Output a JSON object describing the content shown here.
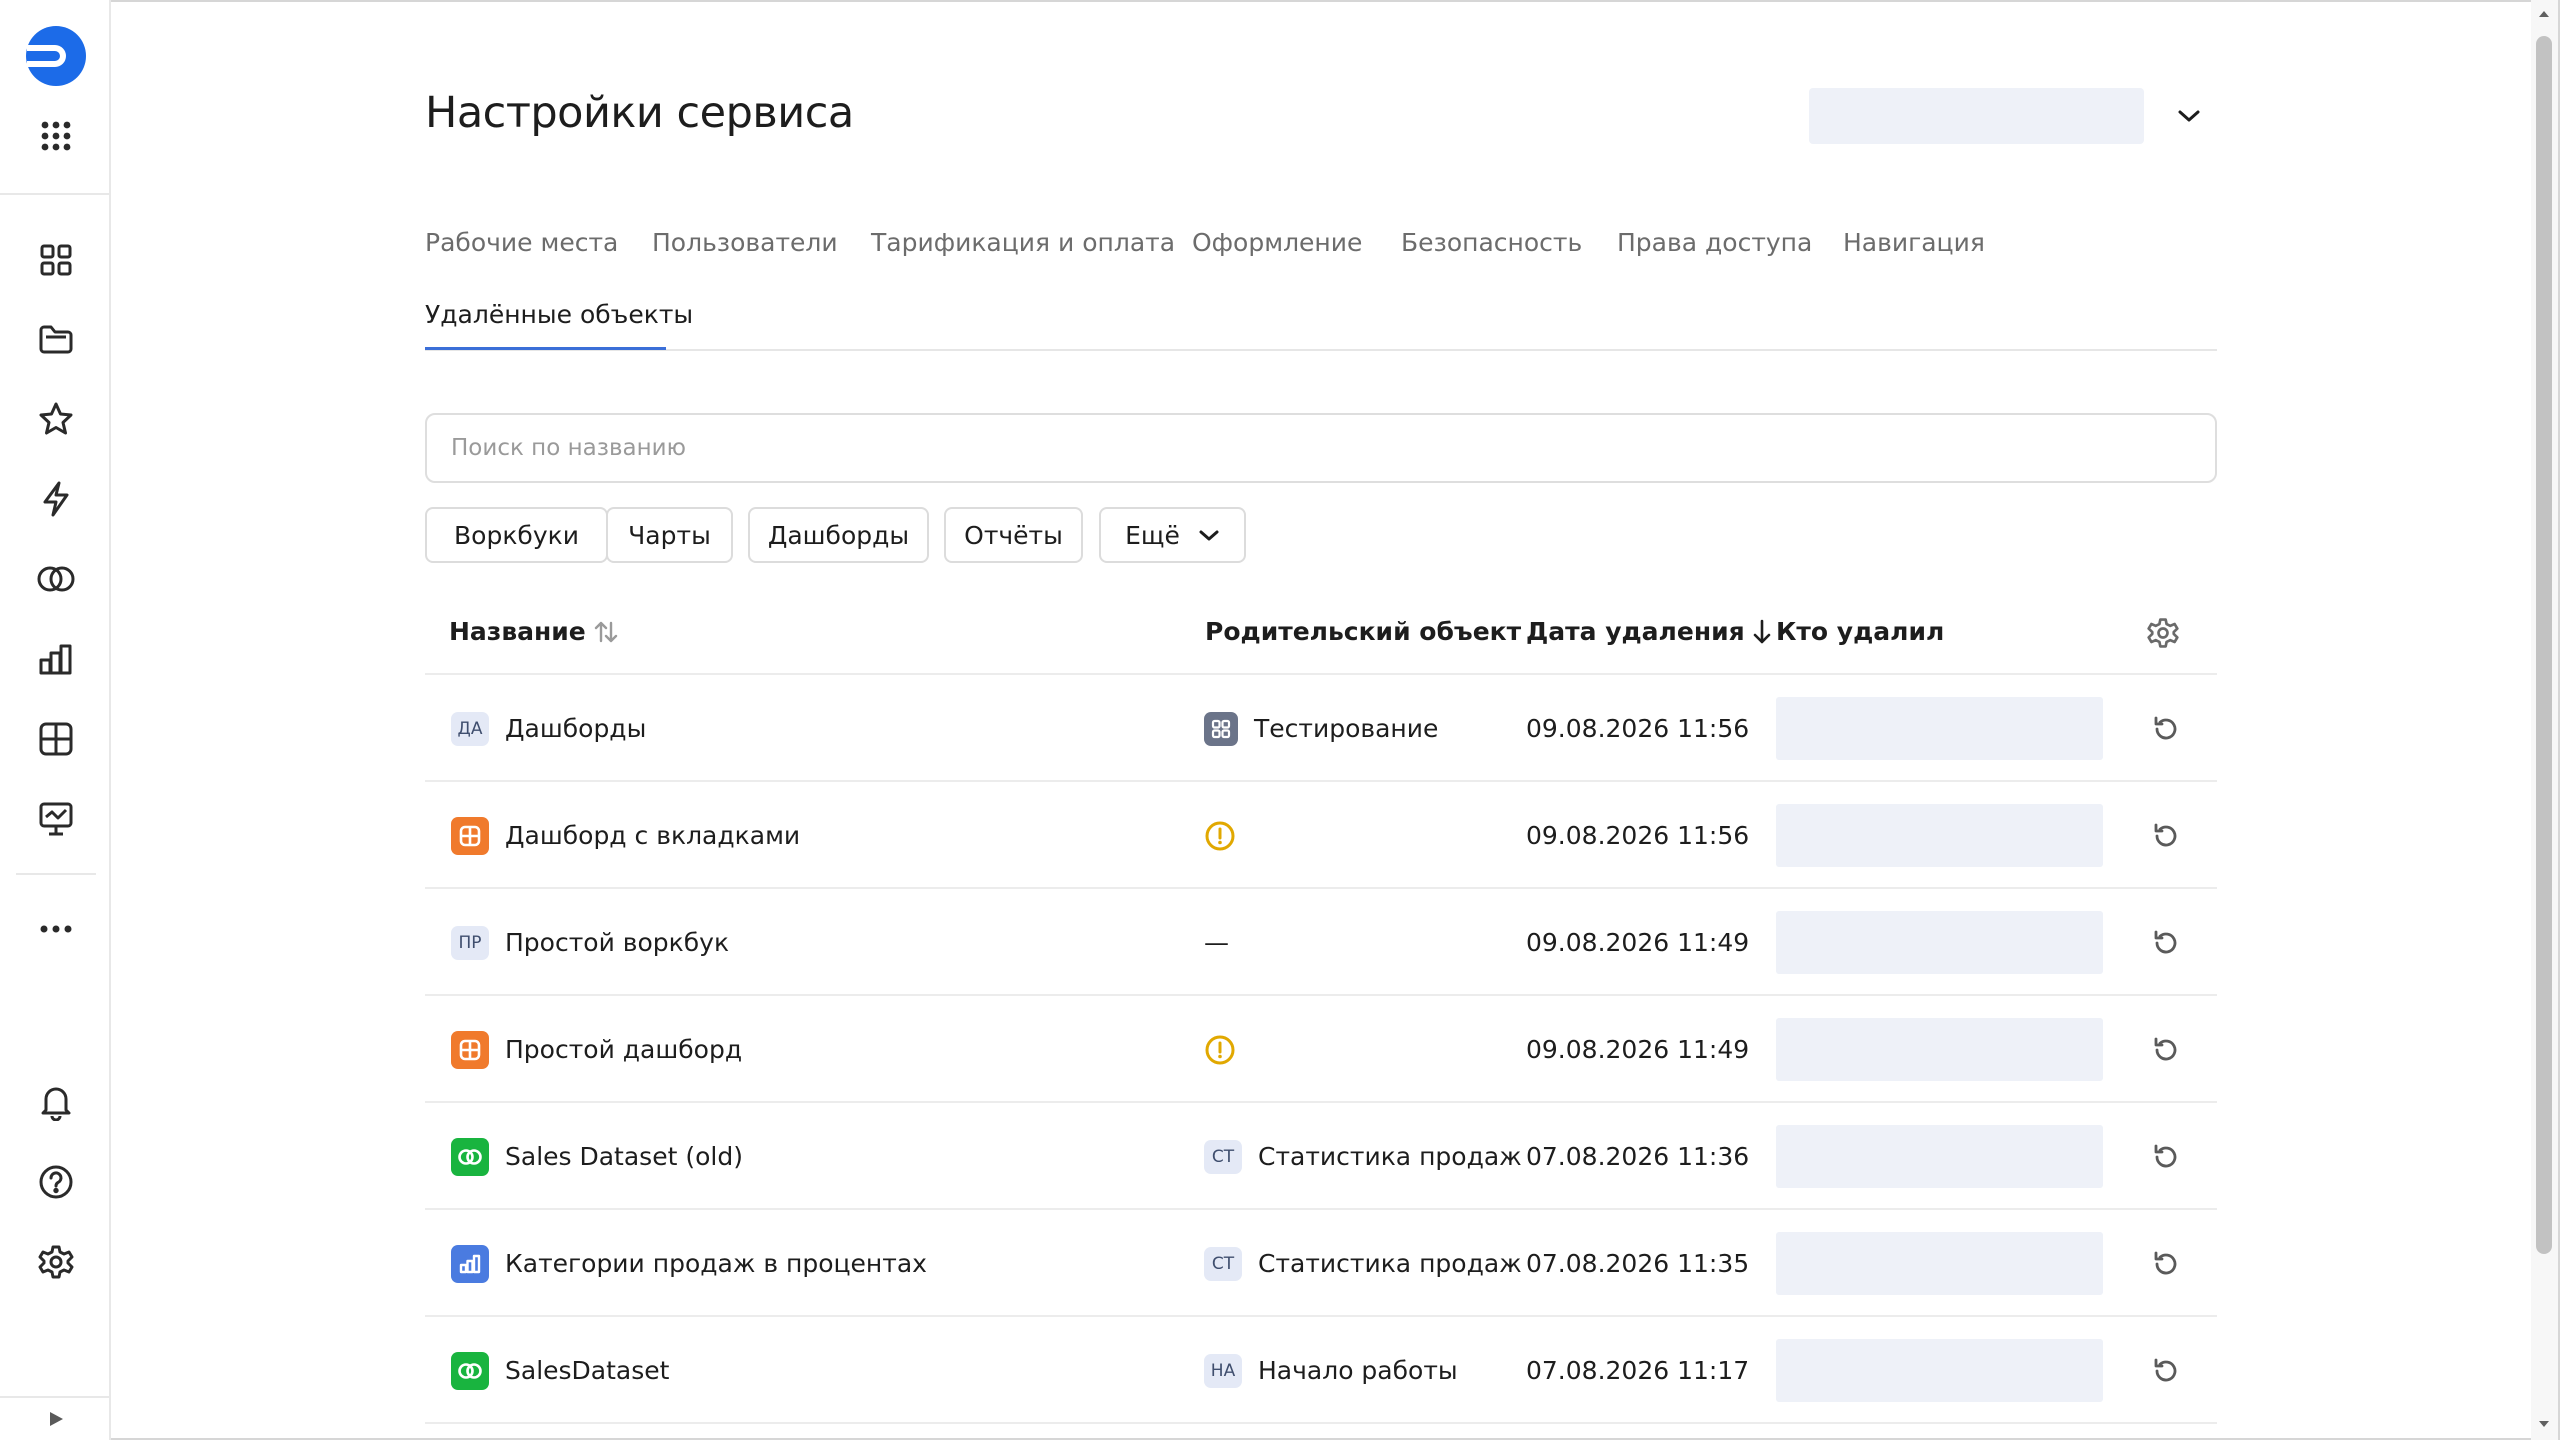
{
  "header": {
    "title": "Настройки сервиса",
    "workspace_selected": ""
  },
  "tabs": [
    {
      "label": "Рабочие места"
    },
    {
      "label": "Пользователи"
    },
    {
      "label": "Тарификация и оплата"
    },
    {
      "label": "Оформление"
    },
    {
      "label": "Безопасность"
    },
    {
      "label": "Права доступа"
    },
    {
      "label": "Навигация"
    },
    {
      "label": "Удалённые объекты",
      "active": true
    }
  ],
  "search": {
    "placeholder": "Поиск по названию",
    "value": ""
  },
  "filters": [
    {
      "label": "Воркбуки"
    },
    {
      "label": "Чарты"
    },
    {
      "label": "Дашборды"
    },
    {
      "label": "Отчёты"
    },
    {
      "label": "Ещё",
      "has_dropdown": true
    }
  ],
  "table": {
    "columns": {
      "name": "Название",
      "parent": "Родительский объект",
      "deleted_at": "Дата удаления",
      "deleted_by": "Кто удалил"
    },
    "sort": {
      "column": "deleted_at",
      "direction": "desc"
    },
    "rows": [
      {
        "name": "Дашборды",
        "icon": "badge",
        "badge": "ДА",
        "parent": "Тестирование",
        "parent_icon": "workbook-icon",
        "parent_badge": "",
        "deleted_at": "09.08.2026 11:56",
        "deleted_by": ""
      },
      {
        "name": "Дашборд с вкладками",
        "icon": "dashboard-icon",
        "badge": "",
        "parent": "",
        "parent_icon": "warning-icon",
        "parent_badge": "",
        "deleted_at": "09.08.2026 11:56",
        "deleted_by": ""
      },
      {
        "name": "Простой воркбук",
        "icon": "badge",
        "badge": "ПР",
        "parent": "—",
        "parent_icon": "",
        "parent_badge": "",
        "deleted_at": "09.08.2026 11:49",
        "deleted_by": ""
      },
      {
        "name": "Простой дашборд",
        "icon": "dashboard-icon",
        "badge": "",
        "parent": "",
        "parent_icon": "warning-icon",
        "parent_badge": "",
        "deleted_at": "09.08.2026 11:49",
        "deleted_by": ""
      },
      {
        "name": "Sales Dataset (old)",
        "icon": "dataset-icon",
        "badge": "",
        "parent": "Статистика продаж",
        "parent_icon": "badge",
        "parent_badge": "СТ",
        "deleted_at": "07.08.2026 11:36",
        "deleted_by": ""
      },
      {
        "name": "Категории продаж в процентах",
        "icon": "chart-icon",
        "badge": "",
        "parent": "Статистика продаж",
        "parent_icon": "badge",
        "parent_badge": "СТ",
        "deleted_at": "07.08.2026 11:35",
        "deleted_by": ""
      },
      {
        "name": "SalesDataset",
        "icon": "dataset-icon",
        "badge": "",
        "parent": "Начало работы",
        "parent_icon": "badge",
        "parent_badge": "НА",
        "deleted_at": "07.08.2026 11:17",
        "deleted_by": ""
      }
    ]
  },
  "colors": {
    "accent": "#3b6fd8",
    "brand": "#1c6be8",
    "dashboard": "#f07a2c",
    "dataset": "#19b43f",
    "chart": "#4a7be0",
    "warning": "#e1a800",
    "placeholder_block": "#eef1f8"
  }
}
